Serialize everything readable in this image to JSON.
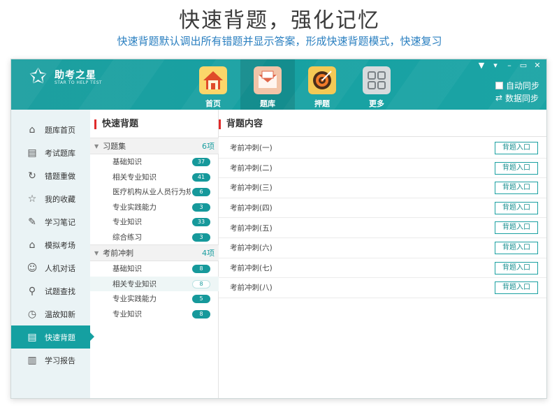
{
  "promo": {
    "title": "快速背题，强化记忆",
    "subtitle": "快速背题默认调出所有错题并显示答案，形成快速背题模式，快速复习"
  },
  "app": {
    "logo_cn": "助考之星",
    "logo_en": "STAR TO HELP TEST",
    "nav": [
      {
        "label": "首页",
        "icon": "house-icon"
      },
      {
        "label": "题库",
        "icon": "envelope-icon"
      },
      {
        "label": "押题",
        "icon": "target-icon"
      },
      {
        "label": "更多",
        "icon": "grid-icon"
      }
    ],
    "window_controls": [
      "▼",
      "▾",
      "–",
      "▭",
      "✕"
    ],
    "sync": {
      "auto": "自动同步",
      "data": "数据同步"
    }
  },
  "sidebar": {
    "items": [
      {
        "label": "题库首页",
        "icon": "home-icon"
      },
      {
        "label": "考试题库",
        "icon": "document-icon"
      },
      {
        "label": "错题重做",
        "icon": "refresh-icon"
      },
      {
        "label": "我的收藏",
        "icon": "star-icon"
      },
      {
        "label": "学习笔记",
        "icon": "edit-icon"
      },
      {
        "label": "模拟考场",
        "icon": "graduation-cap-icon"
      },
      {
        "label": "人机对话",
        "icon": "chat-icon"
      },
      {
        "label": "试题查找",
        "icon": "search-icon"
      },
      {
        "label": "温故知新",
        "icon": "clock-icon"
      },
      {
        "label": "快速背题",
        "icon": "list-doc-icon"
      },
      {
        "label": "学习报告",
        "icon": "book-icon"
      }
    ],
    "active_index": 9
  },
  "middle": {
    "title": "快速背题",
    "groups": [
      {
        "name": "习题集",
        "count": "6项",
        "items": [
          {
            "label": "基础知识",
            "badge": "37"
          },
          {
            "label": "相关专业知识",
            "badge": "41"
          },
          {
            "label": "医疗机构从业人员行为规",
            "badge": "6"
          },
          {
            "label": "专业实践能力",
            "badge": "3"
          },
          {
            "label": "专业知识",
            "badge": "33"
          },
          {
            "label": "综合练习",
            "badge": "3"
          }
        ]
      },
      {
        "name": "考前冲刺",
        "count": "4项",
        "items": [
          {
            "label": "基础知识",
            "badge": "8"
          },
          {
            "label": "相关专业知识",
            "badge": "8"
          },
          {
            "label": "专业实践能力",
            "badge": "5"
          },
          {
            "label": "专业知识",
            "badge": "8"
          }
        ]
      }
    ]
  },
  "right": {
    "title": "背题内容",
    "button_label": "背题入口",
    "rows": [
      "考前冲刺(一)",
      "考前冲刺(二)",
      "考前冲刺(三)",
      "考前冲刺(四)",
      "考前冲刺(五)",
      "考前冲刺(六)",
      "考前冲刺(七)",
      "考前冲刺(八)"
    ]
  }
}
